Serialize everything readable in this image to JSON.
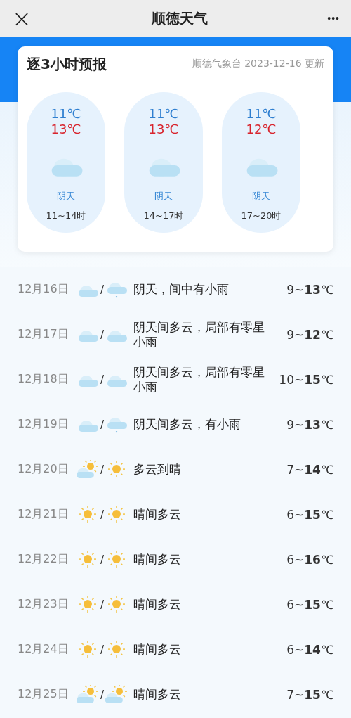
{
  "header": {
    "title": "顺德天气",
    "close": "×",
    "more": "•••"
  },
  "hourly": {
    "title": "逐3小时预报",
    "source": "顺德气象台 2023-12-16 更新",
    "slots": [
      {
        "low": "11℃",
        "high": "13℃",
        "kind": "cloudy",
        "weather": "阴天",
        "time": "11~14时"
      },
      {
        "low": "11℃",
        "high": "13℃",
        "kind": "cloudy",
        "weather": "阴天",
        "time": "14~17时"
      },
      {
        "low": "11℃",
        "high": "12℃",
        "kind": "cloudy",
        "weather": "阴天",
        "time": "17~20时"
      }
    ]
  },
  "daily": [
    {
      "date": "12月16日",
      "icons": [
        {
          "kind": "cloudy"
        },
        {
          "kind": "rain"
        }
      ],
      "separator": "/",
      "weather": "阴天，间中有小雨",
      "temp": "9~**13**℃"
    },
    {
      "date": "12月17日",
      "icons": [
        {
          "kind": "cloudy"
        },
        {
          "kind": "cloudy"
        }
      ],
      "separator": "/",
      "weather": "阴天间多云，局部有零星小雨",
      "temp": "9~**12**℃"
    },
    {
      "date": "12月18日",
      "icons": [
        {
          "kind": "cloudy"
        },
        {
          "kind": "cloudy"
        }
      ],
      "separator": "/",
      "weather": "阴天间多云，局部有零星小雨",
      "temp": "10~**15**℃"
    },
    {
      "date": "12月19日",
      "icons": [
        {
          "kind": "cloudy"
        },
        {
          "kind": "rain"
        }
      ],
      "separator": "/",
      "weather": "阴天间多云，有小雨",
      "temp": "9~**13**℃"
    },
    {
      "date": "12月20日",
      "icons": [
        {
          "kind": "partly"
        },
        {
          "kind": "sunny"
        }
      ],
      "separator": "/",
      "weather": "多云到晴",
      "temp": "7~**14**℃"
    },
    {
      "date": "12月21日",
      "icons": [
        {
          "kind": "sunny"
        },
        {
          "kind": "sunny"
        }
      ],
      "separator": "/",
      "weather": "晴间多云",
      "temp": "6~**15**℃"
    },
    {
      "date": "12月22日",
      "icons": [
        {
          "kind": "sunny"
        },
        {
          "kind": "sunny"
        }
      ],
      "separator": "/",
      "weather": "晴间多云",
      "temp": "6~**16**℃"
    },
    {
      "date": "12月23日",
      "icons": [
        {
          "kind": "sunny"
        },
        {
          "kind": "sunny"
        }
      ],
      "separator": "/",
      "weather": "晴间多云",
      "temp": "6~**15**℃"
    },
    {
      "date": "12月24日",
      "icons": [
        {
          "kind": "sunny"
        },
        {
          "kind": "sunny"
        }
      ],
      "separator": "/",
      "weather": "晴间多云",
      "temp": "6~**14**℃"
    },
    {
      "date": "12月25日",
      "icons": [
        {
          "kind": "partly"
        },
        {
          "kind": "partly"
        }
      ],
      "separator": "/",
      "weather": "晴间多云",
      "temp": "7~**15**℃"
    }
  ]
}
